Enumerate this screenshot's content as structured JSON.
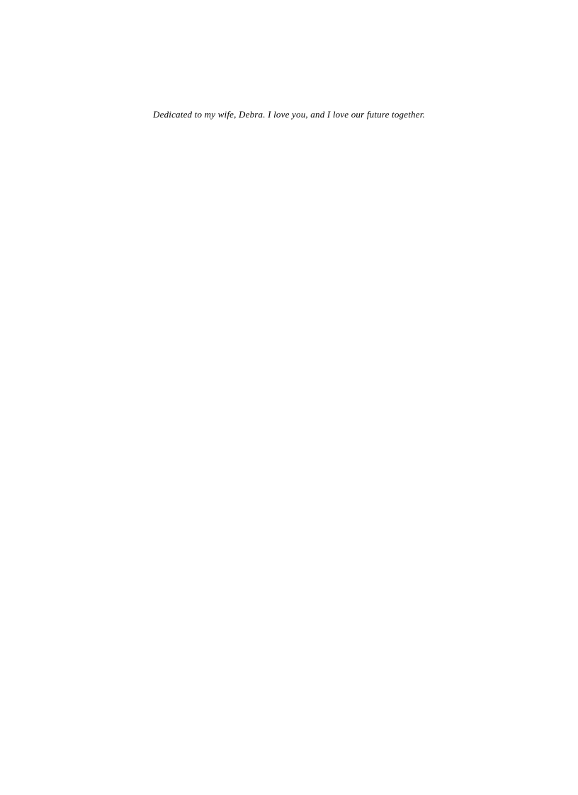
{
  "dedication": {
    "text": "Dedicated to my wife, Debra. I love you, and I love our future together."
  }
}
